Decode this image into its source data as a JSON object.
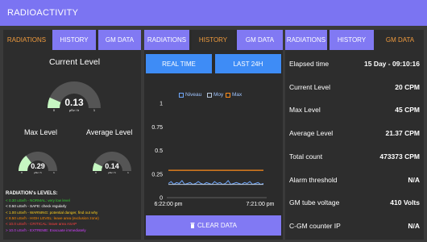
{
  "header": {
    "title": "RADIOACTIVITY"
  },
  "panel1": {
    "tabs": [
      {
        "label": "RADIATIONS",
        "active": true
      },
      {
        "label": "HISTORY",
        "active": false
      },
      {
        "label": "GM DATA",
        "active": false
      }
    ],
    "current": {
      "title": "Current Level",
      "value": "0.13",
      "unit": "µSv / h",
      "min": "0",
      "max": "1",
      "fraction": 0.13
    },
    "max_level": {
      "title": "Max Level",
      "value": "0.29",
      "unit": "µSv / h",
      "min": "0",
      "max": "1",
      "fraction": 0.29
    },
    "avg_level": {
      "title": "Average Level",
      "value": "0.14",
      "unit": "µSv / h",
      "min": "0",
      "max": "1",
      "fraction": 0.14
    },
    "levels_title": "RADIATION's LEVELS:",
    "levels": [
      {
        "text": "< 0.30 uSv/h - NORMAL: very low level",
        "color": "#33cc33"
      },
      {
        "text": "< 0.50 uSv/h - SAFE: check regularly",
        "color": "#ffffff"
      },
      {
        "text": "< 1.00 uSv/h - WARNING: potential danger, find out why",
        "color": "#ffd21f"
      },
      {
        "text": "< 8.50 uSv/h - HIGH LEVEL: leave area (exclusion zone)",
        "color": "#ff8c00"
      },
      {
        "text": "< 10.0 uSv/h - CRITICAL: leave area ASAP",
        "color": "#ff4040"
      },
      {
        "text": "> 10.0 uSv/h - EXTREME: Evacuate immediately",
        "color": "#d040ff"
      }
    ]
  },
  "panel2": {
    "tabs": [
      {
        "label": "RADIATIONS",
        "active": false
      },
      {
        "label": "HISTORY",
        "active": true
      },
      {
        "label": "GM DATA",
        "active": false
      }
    ],
    "btn_realtime": "REAL TIME",
    "btn_last24": "LAST 24H",
    "clear_label": "CLEAR DATA",
    "chart_data": {
      "type": "line",
      "x_ticks": [
        "6:22:00 pm",
        "7:21:00 pm"
      ],
      "y_ticks": [
        "0",
        "0.25",
        "0.5",
        "0.75",
        "1"
      ],
      "ylim": [
        0,
        1
      ],
      "series": [
        {
          "name": "Niveau",
          "color": "#6fa8ff",
          "values": [
            0.15,
            0.17,
            0.14,
            0.16,
            0.15,
            0.18,
            0.14,
            0.15,
            0.16,
            0.14,
            0.15,
            0.17,
            0.15,
            0.14,
            0.16,
            0.15,
            0.14,
            0.17,
            0.15,
            0.16,
            0.14,
            0.15,
            0.18,
            0.14,
            0.15,
            0.16,
            0.15,
            0.14,
            0.16,
            0.15,
            0.17,
            0.14,
            0.15,
            0.16,
            0.14,
            0.15
          ]
        },
        {
          "name": "Moy",
          "color": "#b8c8dc",
          "values": [
            0.14,
            0.14,
            0.14,
            0.14,
            0.14,
            0.14,
            0.14,
            0.14,
            0.14,
            0.14,
            0.14,
            0.14,
            0.14,
            0.14,
            0.14,
            0.14,
            0.14,
            0.14,
            0.14,
            0.14,
            0.14,
            0.14,
            0.14,
            0.14,
            0.14,
            0.14,
            0.14,
            0.14,
            0.14,
            0.14,
            0.14,
            0.14,
            0.14,
            0.14,
            0.14,
            0.14
          ]
        },
        {
          "name": "Max",
          "color": "#ff8c1a",
          "values": [
            0.29,
            0.29,
            0.29,
            0.29,
            0.29,
            0.29,
            0.29,
            0.29,
            0.29,
            0.29,
            0.29,
            0.29,
            0.29,
            0.29,
            0.29,
            0.29,
            0.29,
            0.29,
            0.29,
            0.29,
            0.29,
            0.29,
            0.29,
            0.29,
            0.29,
            0.29,
            0.29,
            0.29,
            0.29,
            0.29,
            0.29,
            0.29,
            0.29,
            0.29,
            0.29,
            0.29
          ]
        }
      ]
    }
  },
  "panel3": {
    "tabs": [
      {
        "label": "RADIATIONS",
        "active": false
      },
      {
        "label": "HISTORY",
        "active": false
      },
      {
        "label": "GM DATA",
        "active": true
      }
    ],
    "rows": [
      {
        "label": "Elapsed time",
        "value": "15 Day - 09:10:16"
      },
      {
        "label": "Current Level",
        "value": "20 CPM"
      },
      {
        "label": "Max Level",
        "value": "45 CPM"
      },
      {
        "label": "Average Level",
        "value": "21.37 CPM"
      },
      {
        "label": "Total count",
        "value": "473373 CPM"
      },
      {
        "label": "Alarm threshold",
        "value": "N/A"
      },
      {
        "label": "GM tube voltage",
        "value": "410 Volts"
      },
      {
        "label": "C-GM counter IP",
        "value": "N/A"
      }
    ]
  },
  "colors": {
    "accent": "#7b74f2",
    "tab_active": "#ee9a3d",
    "button_blue": "#3e8cf6",
    "gauge_fill": "#c6f7c2",
    "gauge_track": "#555555"
  }
}
